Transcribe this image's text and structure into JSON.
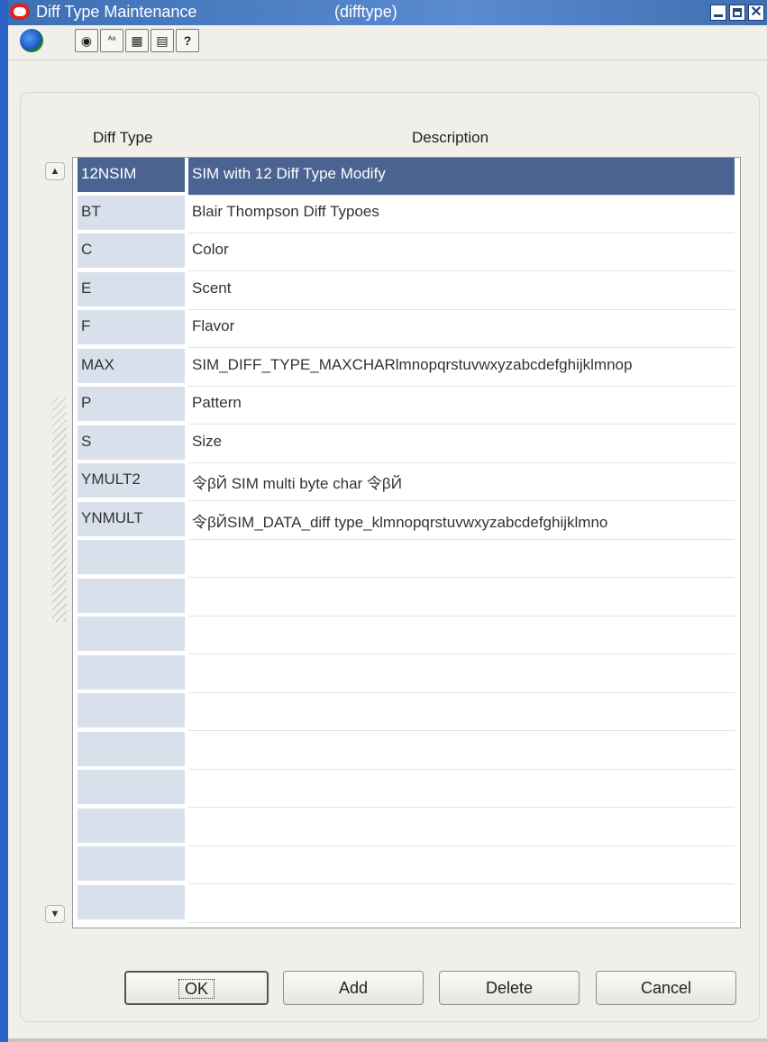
{
  "window": {
    "title": "Diff Type Maintenance",
    "form_id": "(difftype)",
    "close_glyph": "✕"
  },
  "toolbar": {
    "icons": [
      "globe-icon",
      "database-icon",
      "spell-check-icon",
      "calendar-icon",
      "print-icon",
      "help-icon"
    ],
    "globe": "",
    "database": "◉",
    "spell": "ᴬᵃ",
    "calendar": "▦",
    "print": "▤",
    "help": "?"
  },
  "table": {
    "columns": {
      "code": "Diff Type",
      "description": "Description"
    },
    "rows": [
      {
        "code": "12NSIM",
        "description": "SIM with 12 Diff Type Modify",
        "selected": true
      },
      {
        "code": "BT",
        "description": "Blair Thompson Diff Typoes"
      },
      {
        "code": "C",
        "description": "Color"
      },
      {
        "code": "E",
        "description": "Scent"
      },
      {
        "code": "F",
        "description": "Flavor"
      },
      {
        "code": "MAX",
        "description": "SIM_DIFF_TYPE_MAXCHARlmnopqrstuvwxyzabcdefghijklmnop"
      },
      {
        "code": "P",
        "description": "Pattern"
      },
      {
        "code": "S",
        "description": "Size"
      },
      {
        "code": "YMULT2",
        "description": "令βЙ SIM multi byte char 令βЙ"
      },
      {
        "code": "YNMULT",
        "description": "令βЙSIM_DATA_diff type_klmnopqrstuvwxyzabcdefghijklmno"
      }
    ],
    "scroll_up": "▲",
    "scroll_down": "▼"
  },
  "buttons": {
    "ok": "OK",
    "add": "Add",
    "delete": "Delete",
    "cancel": "Cancel"
  },
  "colors": {
    "title_bar": "#3d6fb5",
    "selected_row": "#4a6391",
    "code_cell": "#d8e0ec"
  }
}
